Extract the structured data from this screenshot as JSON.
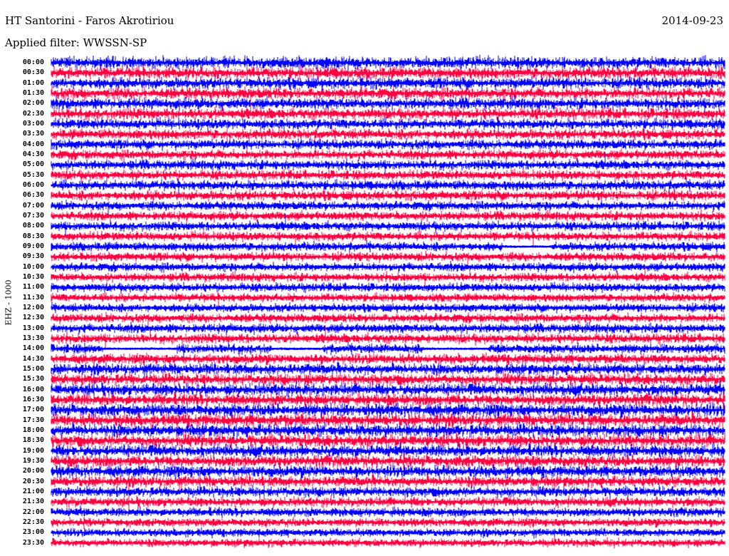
{
  "header": {
    "station": "HT Santorini - Faros Akrotiriou",
    "date": "2014-09-23",
    "filter": "Applied filter: WWSSN-SP"
  },
  "chart_data": {
    "type": "line",
    "subtype": "helicorder",
    "title": "HT Santorini - Faros Akrotiriou",
    "ylabel": "EHZ - 1000",
    "minutes_per_row": 30,
    "colors": [
      "#0000ff",
      "#ff0040"
    ],
    "rows": [
      "00:00",
      "00:30",
      "01:00",
      "01:30",
      "02:00",
      "02:30",
      "03:00",
      "03:30",
      "04:00",
      "04:30",
      "05:00",
      "05:30",
      "06:00",
      "06:30",
      "07:00",
      "07:30",
      "08:00",
      "08:30",
      "09:00",
      "09:30",
      "10:00",
      "10:30",
      "11:00",
      "11:30",
      "12:00",
      "12:30",
      "13:00",
      "13:30",
      "14:00",
      "14:30",
      "15:00",
      "15:30",
      "16:00",
      "16:30",
      "17:00",
      "17:30",
      "18:00",
      "18:30",
      "19:00",
      "19:30",
      "20:00",
      "20:30",
      "21:00",
      "21:30",
      "22:00",
      "22:30",
      "23:00",
      "23:30"
    ],
    "relative_amplitude": [
      1.0,
      1.0,
      0.95,
      0.95,
      0.9,
      0.9,
      0.85,
      0.85,
      0.8,
      0.75,
      0.75,
      0.75,
      0.8,
      0.8,
      0.7,
      0.7,
      0.7,
      0.7,
      0.7,
      0.7,
      0.65,
      0.65,
      0.65,
      0.65,
      0.65,
      0.7,
      0.7,
      0.75,
      0.75,
      0.8,
      0.9,
      0.95,
      1.0,
      1.0,
      1.05,
      1.05,
      1.05,
      1.05,
      1.0,
      1.0,
      0.95,
      0.9,
      0.8,
      0.75,
      0.7,
      0.65,
      0.6,
      0.6
    ],
    "gaps": [
      {
        "row": "09:00",
        "start_min": 20.1,
        "end_min": 22.3
      },
      {
        "row": "14:00",
        "start_min": 2.3,
        "end_min": 5.6
      },
      {
        "row": "14:00",
        "start_min": 9.8,
        "end_min": 12.1
      },
      {
        "row": "14:00",
        "start_min": 16.6,
        "end_min": 19.5
      }
    ]
  }
}
